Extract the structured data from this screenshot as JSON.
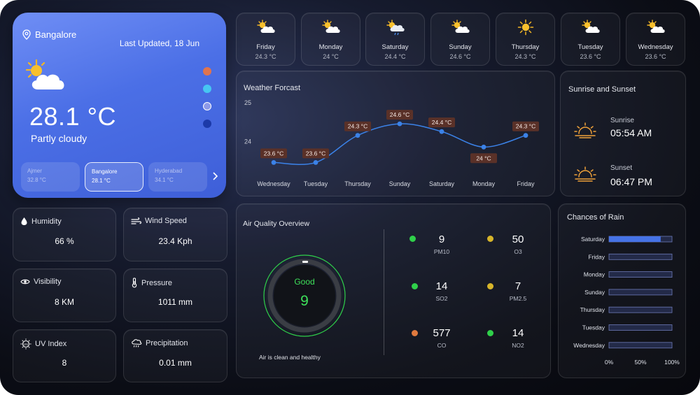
{
  "current": {
    "location": "Bangalore",
    "last_updated": "Last Updated, 18 Jun",
    "temperature": "28.1 °C",
    "condition": "Partly cloudy",
    "icon": "partly-cloudy-icon",
    "theme_dots": [
      "#e0744e",
      "#46c6f2",
      "#8d9ae8",
      "#1c3aa8"
    ],
    "cities": [
      {
        "name": "Ajmer",
        "temp": "32.8 °C",
        "active": false
      },
      {
        "name": "Bangalore",
        "temp": "28.1 °C",
        "active": true
      },
      {
        "name": "Hyderabad",
        "temp": "34.1 °C",
        "active": false
      }
    ]
  },
  "daily": [
    {
      "day": "Friday",
      "temp": "24.3 °C",
      "icon": "partly-cloudy-icon"
    },
    {
      "day": "Monday",
      "temp": "24 °C",
      "icon": "partly-cloudy-icon"
    },
    {
      "day": "Saturday",
      "temp": "24.4 °C",
      "icon": "rain-cloud-icon"
    },
    {
      "day": "Sunday",
      "temp": "24.6 °C",
      "icon": "partly-cloudy-icon"
    },
    {
      "day": "Thursday",
      "temp": "24.3 °C",
      "icon": "sun-icon"
    },
    {
      "day": "Tuesday",
      "temp": "23.6 °C",
      "icon": "partly-cloudy-icon"
    },
    {
      "day": "Wednesday",
      "temp": "23.6 °C",
      "icon": "partly-cloudy-icon"
    }
  ],
  "stats": {
    "humidity": {
      "label": "Humidity",
      "value": "66 %"
    },
    "wind": {
      "label": "Wind Speed",
      "value": "23.4 Kph"
    },
    "visibility": {
      "label": "Visibility",
      "value": "8 KM"
    },
    "pressure": {
      "label": "Pressure",
      "value": "1011 mm"
    },
    "uv": {
      "label": "UV Index",
      "value": "8"
    },
    "precipitation": {
      "label": "Precipitation",
      "value": "0.01 mm"
    }
  },
  "forecast": {
    "title": "Weather Forcast",
    "line_color": "#3b82e8"
  },
  "sun": {
    "title": "Sunrise and Sunset",
    "sunrise_label": "Sunrise",
    "sunrise_time": "05:54 AM",
    "sunset_label": "Sunset",
    "sunset_time": "06:47 PM"
  },
  "air": {
    "title": "Air Quality Overview",
    "status": "Good",
    "index": "9",
    "index_value": 9,
    "note": "Air is clean and healthy",
    "pollutants": [
      {
        "value": "9",
        "name": "PM10",
        "color": "#2fd04a"
      },
      {
        "value": "50",
        "name": "O3",
        "color": "#d7b52a"
      },
      {
        "value": "14",
        "name": "SO2",
        "color": "#2fd04a"
      },
      {
        "value": "7",
        "name": "PM2.5",
        "color": "#d7b52a"
      },
      {
        "value": "577",
        "name": "CO",
        "color": "#e07a3e"
      },
      {
        "value": "14",
        "name": "NO2",
        "color": "#2fd04a"
      }
    ]
  },
  "rain": {
    "title": "Chances of Rain",
    "bar_color": "#4673e6"
  },
  "chart_data": [
    {
      "type": "line",
      "title": "Weather Forcast",
      "x": [
        "Wednesday",
        "Tuesday",
        "Thursday",
        "Sunday",
        "Saturday",
        "Monday",
        "Friday"
      ],
      "series": [
        {
          "values": [
            23.6,
            23.6,
            24.3,
            24.6,
            24.4,
            24,
            24.3
          ]
        }
      ],
      "data_labels": [
        "23.6 °C",
        "23.6 °C",
        "24.3 °C",
        "24.6 °C",
        "24.4 °C",
        "24 °C",
        "24.3 °C"
      ],
      "y_ticks": [
        "25",
        "24"
      ],
      "ylim": [
        23.3,
        25.0
      ],
      "grid": false
    },
    {
      "type": "bar",
      "orientation": "horizontal",
      "title": "Chances of Rain",
      "categories": [
        "Saturday",
        "Friday",
        "Monday",
        "Sunday",
        "Thursday",
        "Tuesday",
        "Wednesday"
      ],
      "values": [
        82,
        0,
        0,
        0,
        0,
        0,
        0
      ],
      "x_ticks": [
        "0%",
        "50%",
        "100%"
      ],
      "xlim": [
        0,
        100
      ]
    }
  ]
}
